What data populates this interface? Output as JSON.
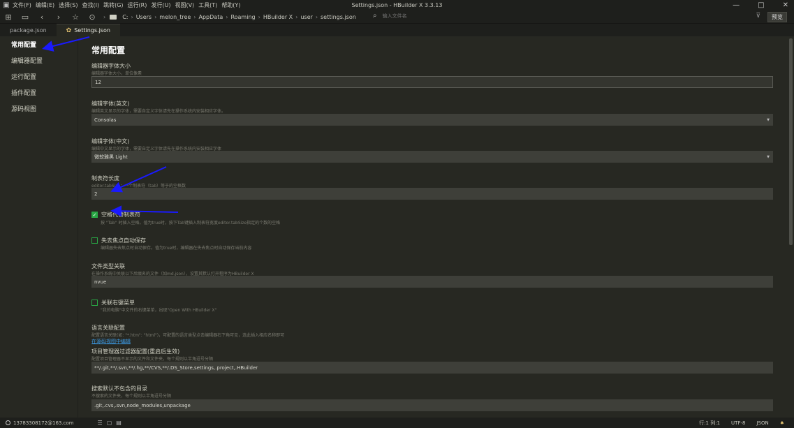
{
  "app": {
    "window_title": "Settings.json - HBuilder X 3.3.13",
    "menu": [
      "文件(F)",
      "编辑(E)",
      "选择(S)",
      "查找(I)",
      "跳转(G)",
      "运行(R)",
      "发行(U)",
      "视图(V)",
      "工具(T)",
      "帮助(Y)"
    ],
    "win_controls": [
      "—",
      "□",
      "✕"
    ]
  },
  "toolbar": {
    "breadcrumb": [
      "C:",
      "Users",
      "melon_tree",
      "AppData",
      "Roaming",
      "HBuilder X",
      "user",
      "settings.json"
    ],
    "file_search_placeholder": "输入文件名",
    "preview_label": "预览"
  },
  "tabs": [
    {
      "label": "package.json"
    },
    {
      "label": "Settings.json"
    }
  ],
  "sidebar": {
    "items": [
      {
        "label": "常用配置"
      },
      {
        "label": "编辑器配置"
      },
      {
        "label": "运行配置"
      },
      {
        "label": "插件配置"
      },
      {
        "label": "源码视图"
      }
    ]
  },
  "main": {
    "title": "常用配置",
    "font_size": {
      "label": "编辑器字体大小",
      "desc": "编辑器字体大小，单位像素",
      "value": "12"
    },
    "font_en": {
      "label": "编辑字体(英文)",
      "desc": "编辑英文显示的字体，需要自定义字体请先在操作系统内安装相应字体。",
      "value": "Consolas"
    },
    "font_cn": {
      "label": "编辑字体(中文)",
      "desc": "编辑中文显示的字体，需要自定义字体请先在操作系统内安装相应字体",
      "value": "微软雅黑 Light"
    },
    "tab_size": {
      "label": "制表符长度",
      "desc": "editor.tabSize：一个制表符（tab）等于的空格数",
      "value": "2"
    },
    "insert_spaces": {
      "label": "空格代替制表符",
      "desc": "按 \"Tab\" 时插入空格。值为true时，按下Tab键插入制表符宽度editor.tabSize指定的个数的空格",
      "checked": true
    },
    "autosave": {
      "label": "失去焦点自动保存",
      "desc": "编辑器失去焦点时自动保存。值为true时，编辑器在失去焦点时自动保存当前内容",
      "checked": false
    },
    "file_assoc": {
      "label": "文件类型关联",
      "desc": "在操作系统中关联以下后缀名的文件（如md,json），设置其默认打开程序为HBuilder X",
      "value": "nvue"
    },
    "context_menu": {
      "label": "关联右键菜单",
      "desc": "\"我的电脑\"中文件的右键菜单，出现\"Open With HBuilder X\"",
      "checked": false
    },
    "lang_assoc": {
      "label": "语言关联配置",
      "desc": "配置语言关联(如: \"*.htm\": \"html\")，可配置的语言类型点击编辑器右下角可见，选此插入相应名称即可",
      "link": "在源码视图中编辑"
    },
    "exclude_filter": {
      "label": "项目管理器过滤器配置(重启后生效)",
      "desc": "配置项目管理器不显示的文件和文件夹，每个规则以半角逗号分隔",
      "value": "**/.git,**/.svn,**/.hg,**/CVS,**/.DS_Store,settings,.project,.HBuilder"
    },
    "search_exclude": {
      "label": "搜索默认不包含的目录",
      "desc": "不搜索的文件夹，每个规则以半角逗号分隔",
      "value": ".git,.cvs,.svn,node_modules,unpackage"
    }
  },
  "status": {
    "user": "13783308172@163.com",
    "position": "行:1  列:1",
    "encoding": "UTF-8",
    "language": "JSON"
  },
  "colors": {
    "background": "#272822",
    "chrome": "#1e1f1c",
    "input": "#3e3f39",
    "checkbox": "#29a745",
    "link": "#3c9be6",
    "annotation_arrow": "#1a1aff"
  }
}
